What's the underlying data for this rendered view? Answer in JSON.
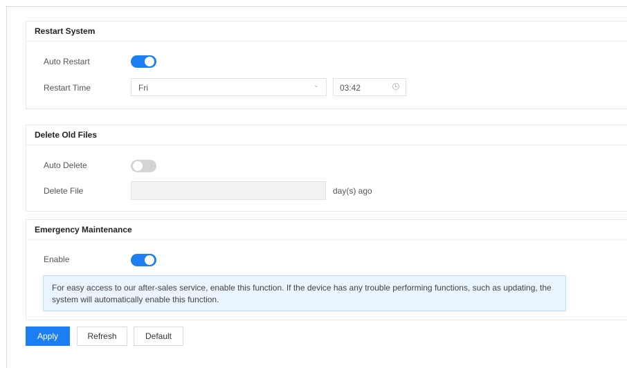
{
  "restart_system": {
    "title": "Restart System",
    "auto_restart_label": "Auto Restart",
    "auto_restart_enabled": true,
    "restart_time_label": "Restart Time",
    "day_value": "Fri",
    "time_value": "03:42"
  },
  "delete_old_files": {
    "title": "Delete Old Files",
    "auto_delete_label": "Auto Delete",
    "auto_delete_enabled": false,
    "delete_file_label": "Delete File",
    "delete_file_value": "",
    "delete_file_suffix": "day(s) ago"
  },
  "emergency_maintenance": {
    "title": "Emergency Maintenance",
    "enable_label": "Enable",
    "enabled": true,
    "notice": "For easy access to our after-sales service, enable this function. If the device has any trouble performing functions, such as updating, the system will automatically enable this function."
  },
  "actions": {
    "apply_label": "Apply",
    "refresh_label": "Refresh",
    "default_label": "Default"
  },
  "icons": {
    "select": "chevron-down-icon",
    "time": "clock-icon"
  },
  "colors": {
    "accent": "#1c7ef3",
    "toggle_off": "#d4d4d4",
    "notice_bg": "#e9f4fc",
    "notice_border": "#b8dcf4"
  }
}
